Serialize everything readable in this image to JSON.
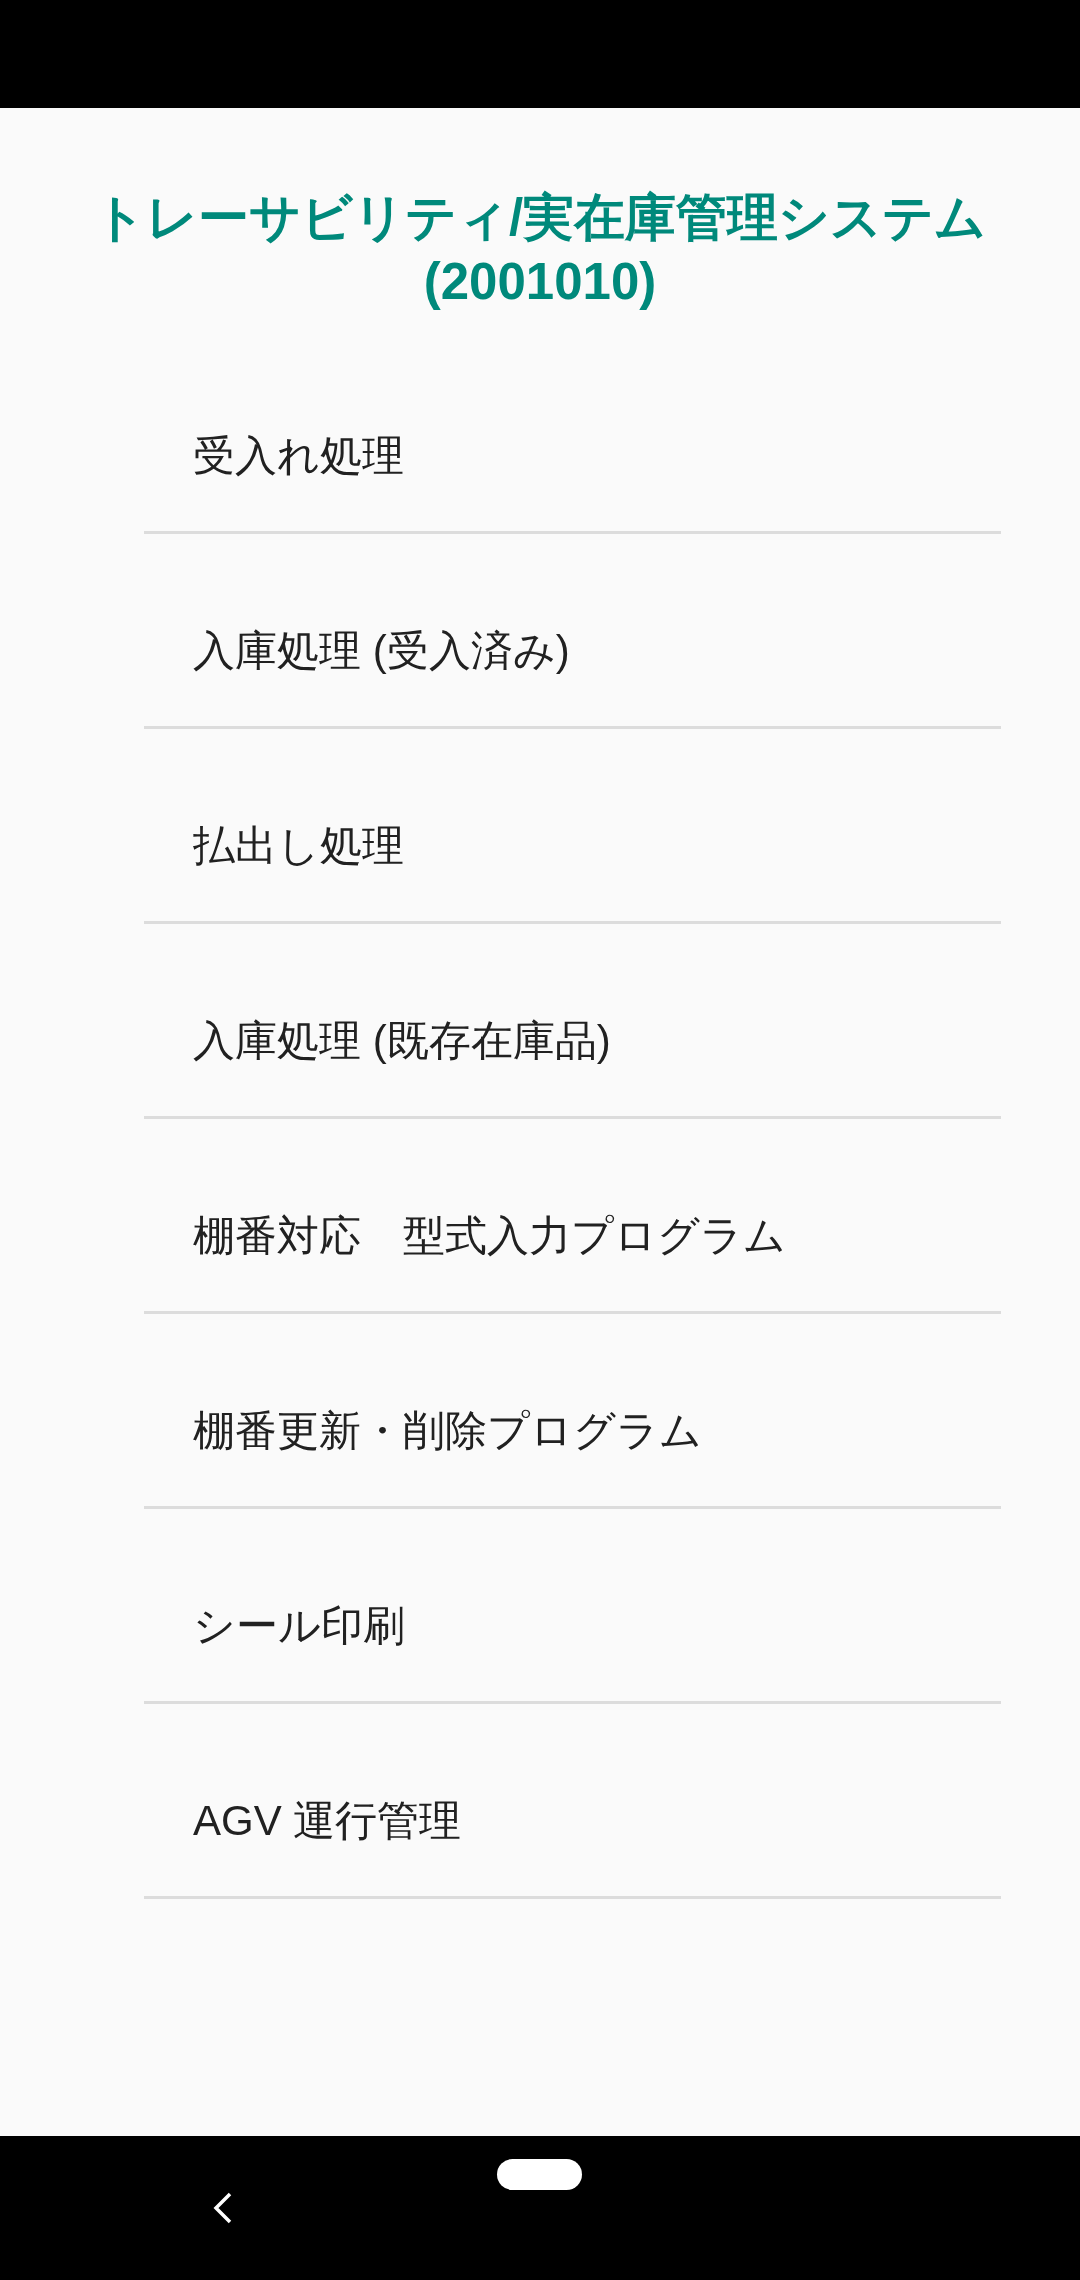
{
  "title": {
    "lines": [
      "トレーサビリティ/実在庫管理システム",
      "(2001010)"
    ]
  },
  "menu_items": [
    {
      "label": "受入れ処理"
    },
    {
      "label": "入庫処理 (受入済み)"
    },
    {
      "label": "払出し処理"
    },
    {
      "label": "入庫処理 (既存在庫品)"
    },
    {
      "label": "棚番対応　型式入力プログラム"
    },
    {
      "label": "棚番更新・削除プログラム"
    },
    {
      "label": "シール印刷"
    },
    {
      "label": "AGV 運行管理"
    }
  ]
}
